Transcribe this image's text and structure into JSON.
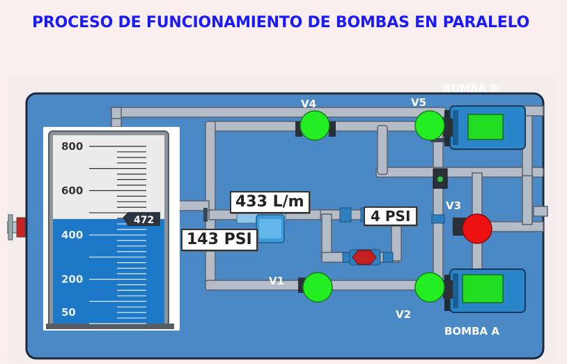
{
  "title": "PROCESO DE FUNCIONAMIENTO DE BOMBAS EN PARALELO",
  "pumps": {
    "bomba_a": {
      "label": "BOMBA A",
      "status_color": "#22dd22"
    },
    "bomba_b": {
      "label": "BOMBA B",
      "status_color": "#22dd22"
    }
  },
  "valves": {
    "v1": {
      "label": "V1",
      "state": "open",
      "color": "#22ee22"
    },
    "v2": {
      "label": "V2",
      "state": "open",
      "color": "#22ee22"
    },
    "v3": {
      "label": "V3",
      "state": "closed",
      "color": "#ee1111"
    },
    "v4": {
      "label": "V4",
      "state": "open",
      "color": "#22ee22"
    },
    "v5": {
      "label": "V5",
      "state": "open",
      "color": "#22ee22"
    }
  },
  "readouts": {
    "flow": "433 L/m",
    "pressure_in": "143 PSI",
    "pressure_out": "4 PSI"
  },
  "tank": {
    "level_value": "472",
    "level": 472,
    "scale_max": 850,
    "scale_min": 0,
    "scale_labels": [
      "800",
      "600",
      "400",
      "200",
      "50"
    ],
    "water_color": "#1e78c8"
  }
}
